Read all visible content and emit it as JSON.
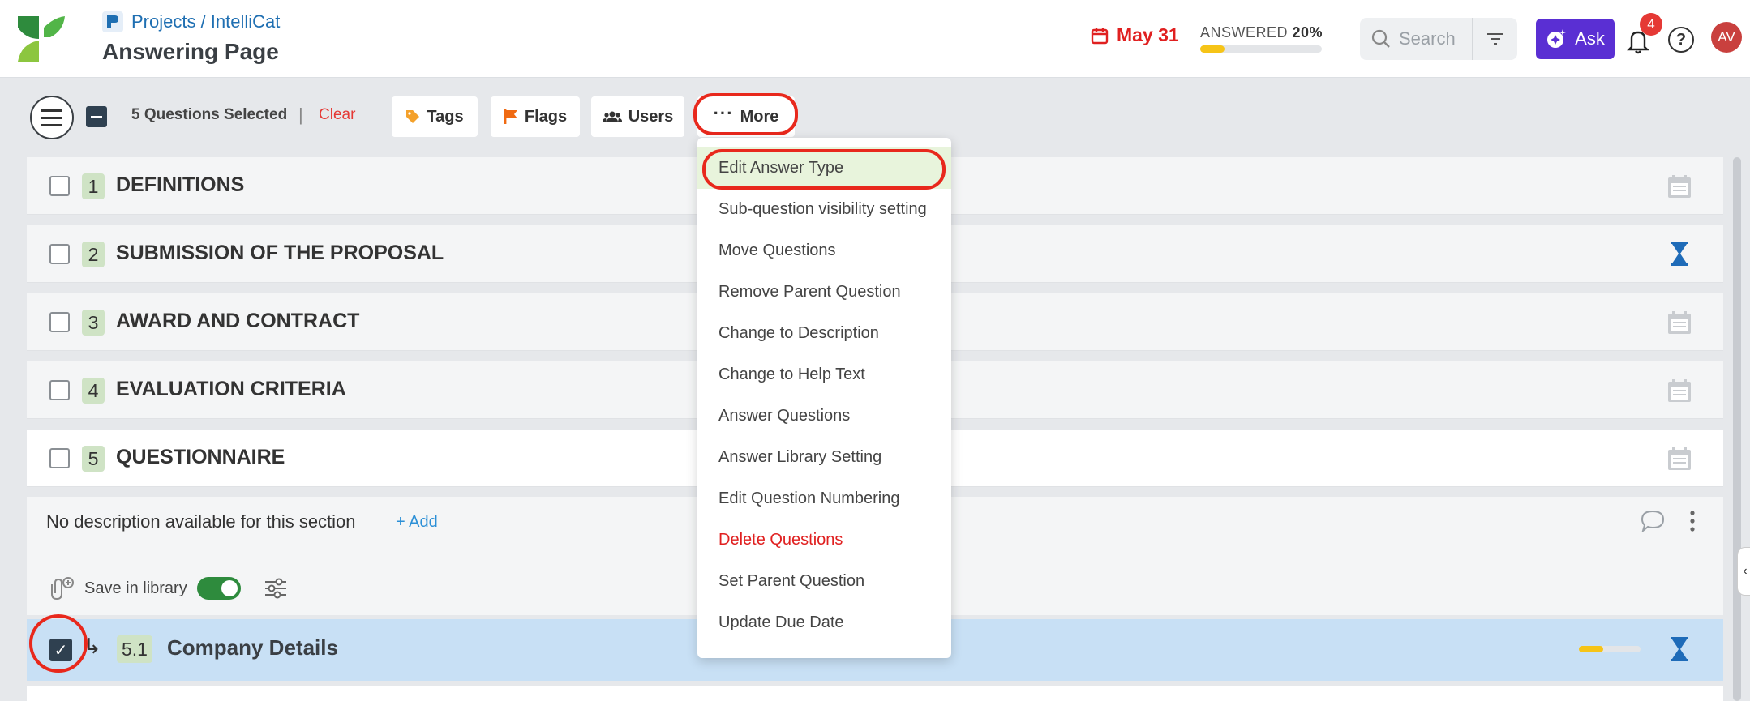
{
  "header": {
    "breadcrumb": "Projects / IntelliCat",
    "title": "Answering Page",
    "due_date": "May 31",
    "answered_label": "ANSWERED",
    "answered_pct": "20%",
    "answered_fraction": 0.2,
    "search_placeholder": "Search",
    "ask_label": "Ask",
    "notification_count": "4",
    "avatar_initials": "AV"
  },
  "toolbar": {
    "selected_text": "5 Questions Selected",
    "separator": "|",
    "clear_label": "Clear",
    "tags_label": "Tags",
    "flags_label": "Flags",
    "users_label": "Users",
    "more_label": "More"
  },
  "sections": [
    {
      "num": "1",
      "title": "DEFINITIONS",
      "icon": "calendar-icon"
    },
    {
      "num": "2",
      "title": "SUBMISSION OF THE PROPOSAL",
      "icon": "hourglass-icon"
    },
    {
      "num": "3",
      "title": "AWARD AND CONTRACT",
      "icon": "calendar-icon"
    },
    {
      "num": "4",
      "title": "EVALUATION CRITERIA",
      "icon": "calendar-icon"
    },
    {
      "num": "5",
      "title": "QUESTIONNAIRE",
      "icon": "calendar-icon"
    }
  ],
  "section_desc": {
    "text": "No description available for this section",
    "add_label": "+ Add",
    "library_label": "Save in library"
  },
  "subquestion": {
    "num": "5.1",
    "title": "Company Details",
    "progress_fraction": 0.4
  },
  "more_menu": [
    "Edit Answer Type",
    "Sub-question visibility setting",
    "Move Questions",
    "Remove Parent Question",
    "Change to Description",
    "Change to Help Text",
    "Answer Questions",
    "Answer Library Setting",
    "Edit Question Numbering",
    "Delete Questions",
    "Set Parent Question",
    "Update Due Date"
  ],
  "colors": {
    "accent_purple": "#5a2fd3",
    "danger_red": "#e02020",
    "highlight_ring": "#e8281c",
    "progress_yellow": "#f6c417",
    "number_badge_green": "#cfe3c5",
    "selected_row_blue": "#c8e0f5"
  }
}
